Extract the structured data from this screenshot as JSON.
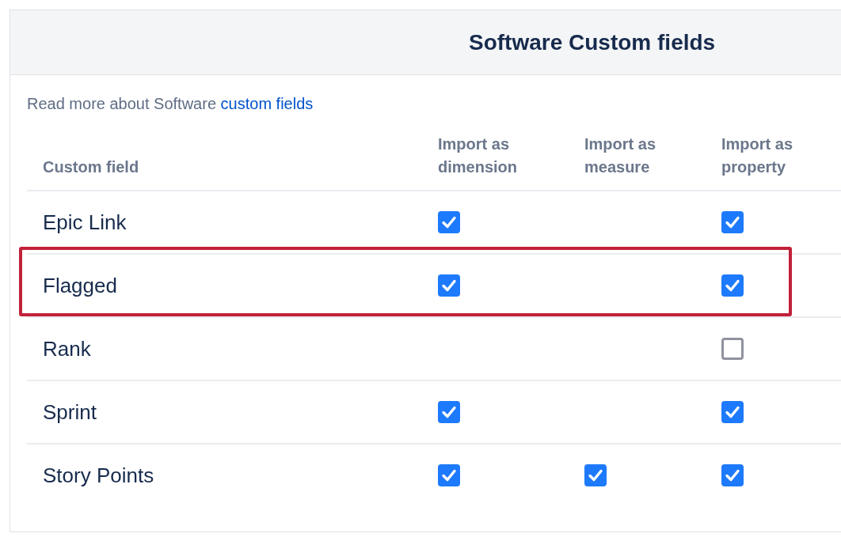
{
  "panel": {
    "title": "Software Custom fields"
  },
  "intro": {
    "text": "Read more about Software ",
    "link": "custom fields"
  },
  "table": {
    "columns": [
      "Custom field",
      "Import as dimension",
      "Import as measure",
      "Import as property"
    ],
    "rows": [
      {
        "name": "Epic Link",
        "highlighted": false,
        "dimension": true,
        "property": true
      },
      {
        "name": "Flagged",
        "highlighted": true,
        "dimension": true,
        "property": true
      },
      {
        "name": "Rank",
        "highlighted": false,
        "property": false
      },
      {
        "name": "Sprint",
        "highlighted": false,
        "dimension": true,
        "property": true
      },
      {
        "name": "Story Points",
        "highlighted": false,
        "dimension": true,
        "measure": true,
        "property": true
      }
    ]
  }
}
